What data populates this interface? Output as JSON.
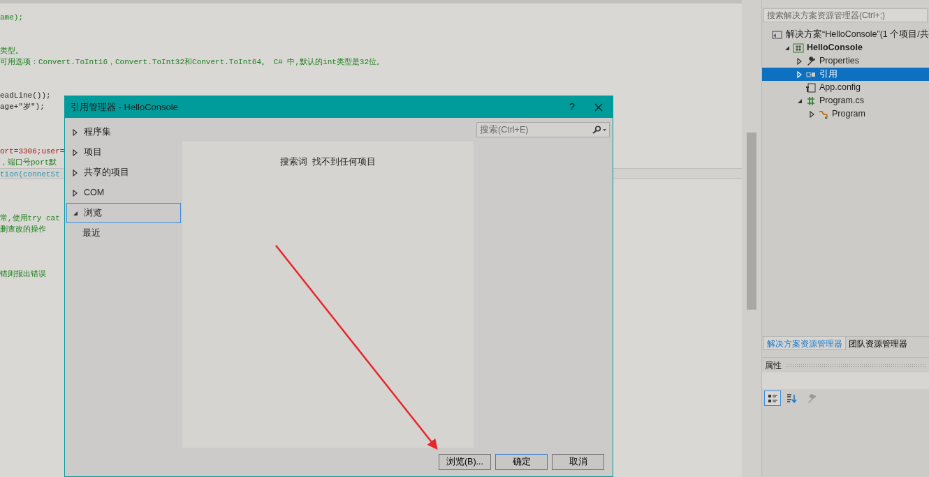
{
  "editor": {
    "lines": [
      {
        "text": "ame);",
        "kind": "comment",
        "current": false
      },
      {
        "kind": "blank",
        "current": false
      },
      {
        "kind": "blank",
        "current": false
      },
      {
        "text": "类型。",
        "kind": "comment",
        "current": false
      },
      {
        "text": "可用选项：Convert.ToInt16，Convert.ToInt32和Convert.ToInt64。 C# 中,默认的int类型是32位。",
        "kind": "comment",
        "current": false
      },
      {
        "kind": "blank",
        "current": false
      },
      {
        "kind": "blank",
        "current": false
      },
      {
        "text": "eadLine());",
        "kind": "plain",
        "current": false
      },
      {
        "text": "age+\"岁\");",
        "kind": "plain",
        "current": false
      },
      {
        "kind": "blank",
        "current": false
      },
      {
        "kind": "blank",
        "current": false
      },
      {
        "kind": "blank",
        "current": false
      },
      {
        "text": "ort=3306;user=",
        "kind": "string",
        "current": false
      },
      {
        "text": "，端口号port默",
        "kind": "comment",
        "current": false
      },
      {
        "text": "tion(connetSt",
        "kind": "type",
        "current": true
      },
      {
        "kind": "blank",
        "current": false
      },
      {
        "kind": "blank",
        "current": false
      },
      {
        "kind": "blank",
        "current": false
      },
      {
        "text": "常,使用try cat",
        "kind": "comment",
        "current": false
      },
      {
        "text": "删查改的操作",
        "kind": "comment",
        "current": false
      },
      {
        "kind": "blank",
        "current": false
      },
      {
        "kind": "blank",
        "current": false
      },
      {
        "kind": "blank",
        "current": false
      },
      {
        "text": "错则报出错误",
        "kind": "comment",
        "current": false
      }
    ]
  },
  "solution_explorer": {
    "search": {
      "placeholder": "搜索解决方案资源管理器(Ctrl+;)"
    },
    "tree": [
      {
        "label": "解决方案“HelloConsole”(1 个项目/共",
        "kind": "solution",
        "expandable": false,
        "selected": false,
        "bold": false,
        "children": [
          {
            "label": "HelloConsole",
            "kind": "project",
            "expandable": true,
            "expanded": true,
            "selected": false,
            "bold": true,
            "children": [
              {
                "label": "Properties",
                "kind": "wrench",
                "expandable": true,
                "expanded": false,
                "selected": false,
                "bold": false
              },
              {
                "label": "引用",
                "kind": "reference",
                "expandable": true,
                "expanded": false,
                "selected": true,
                "bold": false
              },
              {
                "label": "App.config",
                "kind": "config",
                "expandable": false,
                "selected": false,
                "bold": false
              },
              {
                "label": "Program.cs",
                "kind": "csfile",
                "expandable": true,
                "expanded": true,
                "selected": false,
                "bold": false,
                "children": [
                  {
                    "label": "Program",
                    "kind": "class",
                    "expandable": true,
                    "expanded": false,
                    "selected": false,
                    "bold": false
                  }
                ]
              }
            ]
          }
        ]
      }
    ],
    "tabs": [
      {
        "label": "解决方案资源管理器",
        "selected": true
      },
      {
        "label": "团队资源管理器",
        "selected": false
      }
    ]
  },
  "properties": {
    "title": "属性",
    "tools": [
      {
        "kind": "categorized",
        "selected": true
      },
      {
        "kind": "alphabetical",
        "selected": false
      },
      {
        "kind": "wrench",
        "selected": false
      }
    ]
  },
  "dialog": {
    "title": "引用管理器 - HelloConsole",
    "help": "?",
    "nav": [
      {
        "label": "程序集",
        "expandable": true,
        "expanded": false,
        "selected": false
      },
      {
        "label": "项目",
        "expandable": true,
        "expanded": false,
        "selected": false
      },
      {
        "label": "共享的项目",
        "expandable": true,
        "expanded": false,
        "selected": false
      },
      {
        "label": "COM",
        "expandable": true,
        "expanded": false,
        "selected": false
      },
      {
        "label": "浏览",
        "expandable": true,
        "expanded": true,
        "selected": true,
        "children": [
          {
            "label": "最近",
            "expandable": false,
            "selected": false
          }
        ]
      }
    ],
    "search": {
      "placeholder": "搜索(Ctrl+E)"
    },
    "message": "搜索词  找不到任何项目",
    "buttons": [
      {
        "label": "浏览(B)...",
        "default": false
      },
      {
        "label": "确定",
        "default": true
      },
      {
        "label": "取消",
        "default": false
      }
    ]
  }
}
